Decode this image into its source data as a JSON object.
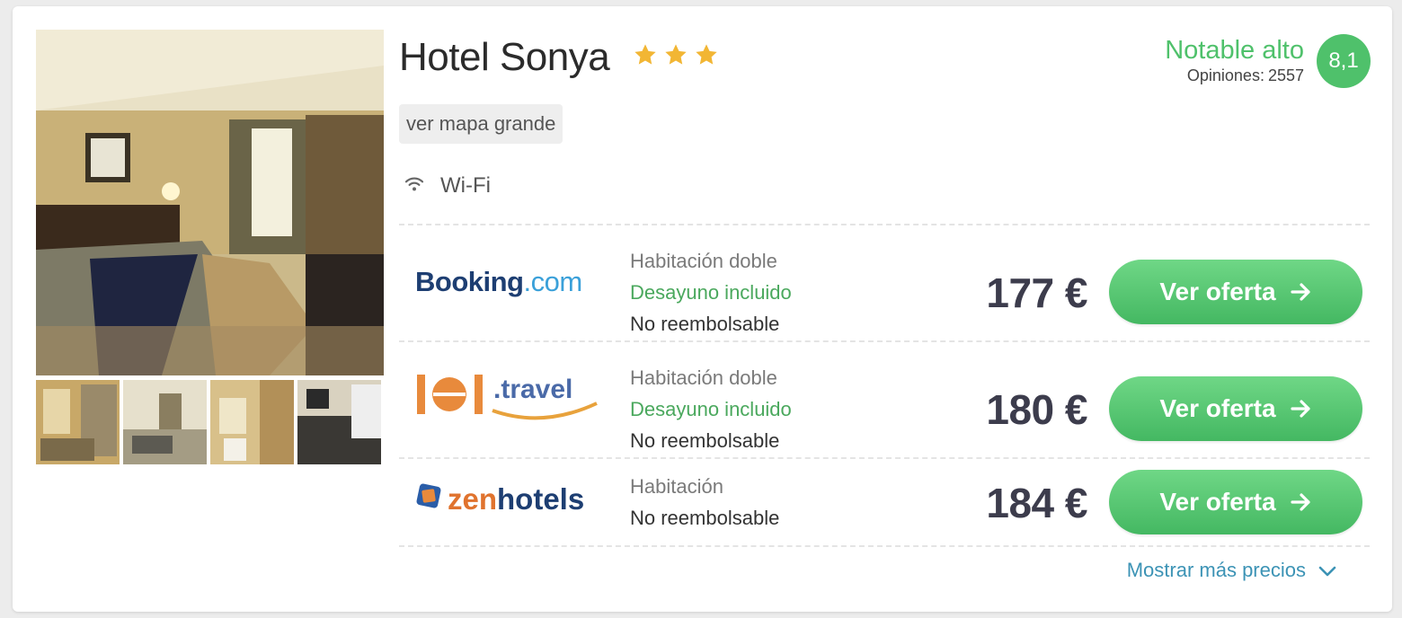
{
  "hotel": {
    "name": "Hotel Sonya",
    "stars": 3,
    "map_button": "ver mapa grande",
    "amenities": [
      {
        "icon": "wifi-icon",
        "label": "Wi-Fi"
      }
    ]
  },
  "rating": {
    "label": "Notable alto",
    "reviews_label": "Opiniones:",
    "reviews_count": "2557",
    "score": "8,1"
  },
  "offers": [
    {
      "provider": {
        "part1": "Booking",
        "part2": ".com"
      },
      "room_type": "Habitación doble",
      "breakfast": "Desayuno incluido",
      "policy": "No reembolsable",
      "price": "177 €",
      "button": "Ver oferta"
    },
    {
      "provider": {
        "part1": "lol",
        "part2": ".travel"
      },
      "room_type": "Habitación doble",
      "breakfast": "Desayuno incluido",
      "policy": "No reembolsable",
      "price": "180 €",
      "button": "Ver oferta"
    },
    {
      "provider": {
        "part1": "zen",
        "part2": "hotels"
      },
      "room_type": "Habitación",
      "policy": "No reembolsable",
      "price": "184 €",
      "button": "Ver oferta"
    }
  ],
  "more_prices": "Mostrar más precios",
  "colors": {
    "accent_green": "#4fc16b",
    "breakfast_green": "#4aa85d",
    "link_blue": "#3c93b5",
    "star_gold": "#f2b634",
    "price_text": "#3c3c4c"
  }
}
